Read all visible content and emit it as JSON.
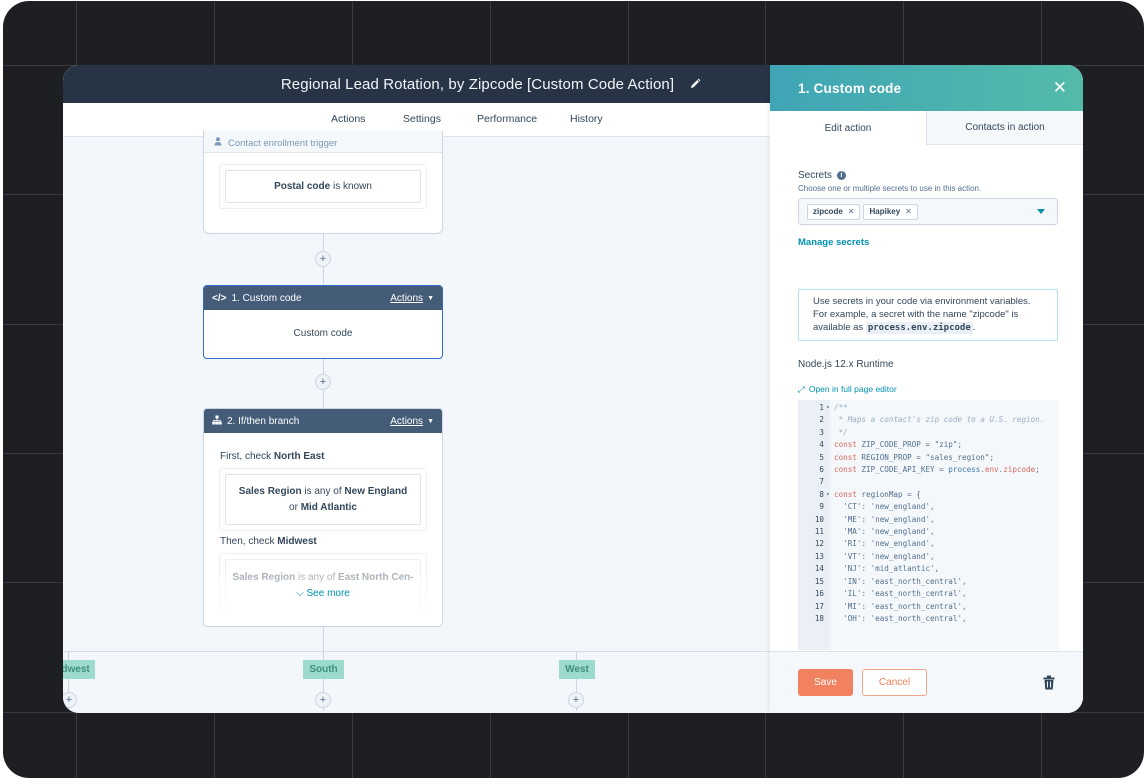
{
  "window": {
    "title": "Regional Lead Rotation, by Zipcode [Custom Code Action]"
  },
  "tabs": [
    {
      "label": "Actions",
      "active": true
    },
    {
      "label": "Settings",
      "active": false
    },
    {
      "label": "Performance",
      "active": false
    },
    {
      "label": "History",
      "active": false
    }
  ],
  "workflow": {
    "trigger": {
      "header": "Contact enrollment trigger",
      "filter_bold": "Postal code",
      "filter_rest": " is known"
    },
    "action1": {
      "title": "1. Custom code",
      "actions_label": "Actions",
      "body": "Custom code"
    },
    "action2": {
      "title": "2. If/then branch",
      "actions_label": "Actions",
      "first_prefix": "First, check ",
      "first_name": "North East",
      "first_cond": {
        "prop": "Sales Region",
        "op": " is any of ",
        "v1": "New England",
        "or": " or ",
        "v2": "Mid Atlantic"
      },
      "then_prefix": "Then, check ",
      "then_name": "Midwest",
      "second_cond": {
        "prop": "Sales Region",
        "op": " is any of ",
        "v1": "East North Cen-"
      },
      "see_more": "See more"
    },
    "branches": [
      "Midwest",
      "South",
      "West"
    ]
  },
  "panel": {
    "title": "1. Custom code",
    "tabs": [
      {
        "label": "Edit action",
        "active": true
      },
      {
        "label": "Contacts in action",
        "active": false
      }
    ],
    "secrets": {
      "label": "Secrets",
      "help": "Choose one or multiple secrets to use in this action.",
      "selected": [
        "zipcode",
        "Hapikey"
      ],
      "manage_link": "Manage secrets"
    },
    "note": {
      "line1": "Use secrets in your code via environment variables.",
      "line2": "For example, a secret with the name \"zipcode\" is",
      "line3_prefix": "available as ",
      "code": "process.env.zipcode",
      "line3_suffix": "."
    },
    "runtime": "Node.js 12.x Runtime",
    "open_editor": "Open in full page editor",
    "code_lines": [
      {
        "n": "1",
        "fold": true,
        "text": "/**"
      },
      {
        "n": "2",
        "fold": false,
        "text": " * Maps a contact's zip code to a U.S. region."
      },
      {
        "n": "3",
        "fold": false,
        "text": " */"
      },
      {
        "n": "4",
        "fold": false,
        "text": "const ZIP_CODE_PROP = \"zip\";"
      },
      {
        "n": "5",
        "fold": false,
        "text": "const REGION_PROP = \"sales_region\";"
      },
      {
        "n": "6",
        "fold": false,
        "text": "const ZIP_CODE_API_KEY = process.env.zipcode;"
      },
      {
        "n": "7",
        "fold": false,
        "text": ""
      },
      {
        "n": "8",
        "fold": true,
        "text": "const regionMap = {"
      },
      {
        "n": "9",
        "fold": false,
        "text": "  'CT': 'new_england',"
      },
      {
        "n": "10",
        "fold": false,
        "text": "  'ME': 'new_england',"
      },
      {
        "n": "11",
        "fold": false,
        "text": "  'MA': 'new_england',"
      },
      {
        "n": "12",
        "fold": false,
        "text": "  'RI': 'new_england',"
      },
      {
        "n": "13",
        "fold": false,
        "text": "  'VT': 'new_england',"
      },
      {
        "n": "14",
        "fold": false,
        "text": "  'NJ': 'mid_atlantic',"
      },
      {
        "n": "15",
        "fold": false,
        "text": "  'IN': 'east_north_central',"
      },
      {
        "n": "16",
        "fold": false,
        "text": "  'IL': 'east_north_central',"
      },
      {
        "n": "17",
        "fold": false,
        "text": "  'MI': 'east_north_central',"
      },
      {
        "n": "18",
        "fold": false,
        "text": "  'OH': 'east_north_central',"
      }
    ],
    "footer": {
      "save": "Save",
      "cancel": "Cancel"
    }
  },
  "colors": {
    "header_dark": "#263445",
    "accent_teal": "#0091ae",
    "save_orange": "#f2815f",
    "branch_green": "#9ddbcf",
    "selected_border": "#2f6ccd"
  }
}
